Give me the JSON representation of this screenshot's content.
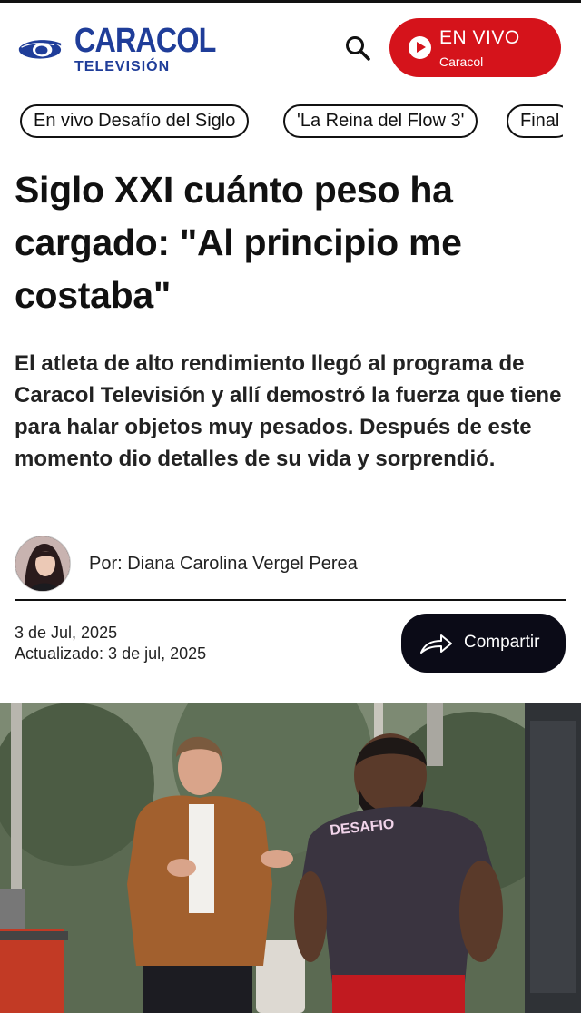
{
  "header": {
    "logo": {
      "name": "caracol-logo",
      "line1": "CARACOL",
      "line2": "TELEVISIÓN",
      "brand_color": "#1f3d99"
    },
    "search_icon": "search-icon",
    "live": {
      "label": "EN VIVO",
      "sublabel": "Caracol",
      "color": "#d5131b",
      "icon": "play-icon"
    }
  },
  "chips": [
    {
      "label": "En vivo Desafío del Siglo"
    },
    {
      "label": "'La Reina del Flow 3'"
    },
    {
      "label": "Final"
    }
  ],
  "article": {
    "title": "Siglo XXI cuánto peso ha cargado: \"Al principio me costaba\"",
    "lead": "El atleta de alto rendimiento llegó al programa de Caracol Televisión y allí demostró la fuerza que tiene para halar objetos muy pesados. Después de este momento dio detalles de su vida y sorprendió.",
    "author": "Por: Diana Carolina Vergel Perea",
    "date": "3 de Jul, 2025",
    "updated": "Actualizado: 3 de jul, 2025",
    "share_label": "Compartir",
    "share_icon": "share-arrow-icon"
  },
  "hero_image": {
    "shirt_text": "DESAFIO"
  }
}
